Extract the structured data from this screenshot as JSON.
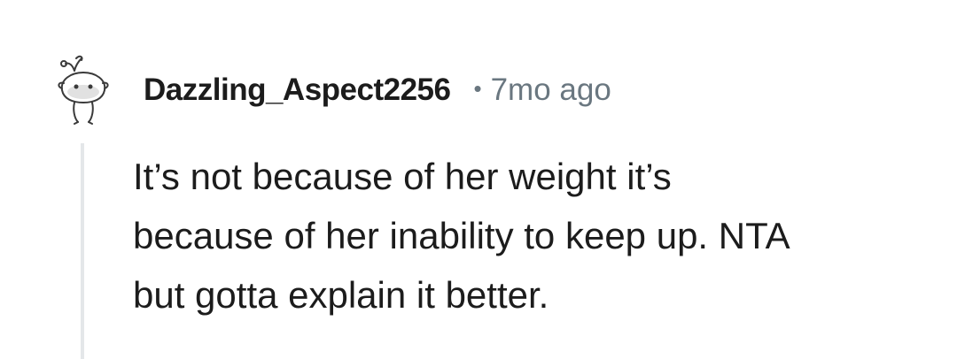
{
  "comment": {
    "author": "Dazzling_Aspect2256",
    "separator": "•",
    "time_ago": "7mo ago",
    "body_lines": [
      "It’s not because of her weight it’s",
      "because of her inability to keep up. NTA",
      "but gotta explain it better."
    ],
    "avatar_icon": "snoo-avatar-icon",
    "thread_line_color": "#e4e7e9",
    "text_color": "#1c1c1c",
    "meta_color": "#6a7780"
  }
}
